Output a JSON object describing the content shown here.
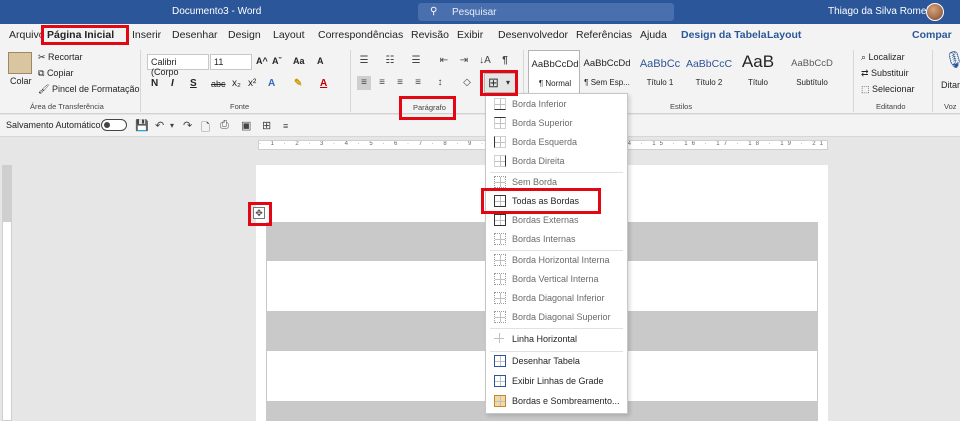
{
  "titlebar": {
    "doc_title": "Documento3  -  Word",
    "search_placeholder": "Pesquisar",
    "search_icon": "search-icon",
    "user_name": "Thiago da Silva Romeiro"
  },
  "tabs": [
    "Arquivo",
    "Página Inicial",
    "Inserir",
    "Desenhar",
    "Design",
    "Layout",
    "Correspondências",
    "Revisão",
    "Exibir",
    "Desenvolvedor",
    "Referências",
    "Ajuda",
    "Design da Tabela",
    "Layout"
  ],
  "share_label": "Compar",
  "clipboard": {
    "paste": "Colar",
    "cut": "Recortar",
    "copy": "Copiar",
    "format_painter": "Pincel de Formatação",
    "label": "Área de Transferência"
  },
  "font": {
    "family": "Calibri (Corpo",
    "size": "11",
    "label": "Fonte",
    "buttons": [
      "N",
      "I",
      "S",
      "abc",
      "x₂",
      "x²",
      "A"
    ]
  },
  "paragraph": {
    "label": "Parágrafo",
    "pilcrow": "¶",
    "sort": "↓A"
  },
  "styles": {
    "label": "Estilos",
    "items": [
      {
        "preview": "AaBbCcDd",
        "name": "¶ Normal"
      },
      {
        "preview": "AaBbCcDd",
        "name": "¶ Sem Esp..."
      },
      {
        "preview": "AaBbCc",
        "name": "Título 1"
      },
      {
        "preview": "AaBbCcC",
        "name": "Título 2"
      },
      {
        "preview": "AaB",
        "name": "Título"
      },
      {
        "preview": "AaBbCcD",
        "name": "Subtítulo"
      }
    ]
  },
  "editing": {
    "find": "Localizar",
    "replace": "Substituir",
    "select": "Selecionar",
    "label": "Editando"
  },
  "voice": {
    "dictate": "Ditar",
    "label": "Voz"
  },
  "qat": {
    "autosave": "Salvamento Automático",
    "autosave_state": "off"
  },
  "ruler_text": "· 1 · 2 · 3 · 4 · 5 · 6 · 7 · 8 · 9 · 10 · 11 · 12 · 13 · 14 · 15 · 16 · 17 · 18 · 19 · 21",
  "borders_menu": [
    {
      "label": "Borda Inferior"
    },
    {
      "label": "Borda Superior"
    },
    {
      "label": "Borda Esquerda"
    },
    {
      "label": "Borda Direita"
    },
    {
      "label": "Sem Borda"
    },
    {
      "label": "Todas as Bordas"
    },
    {
      "label": "Bordas Externas"
    },
    {
      "label": "Bordas Internas"
    },
    {
      "label": "Borda Horizontal Interna"
    },
    {
      "label": "Borda Vertical Interna"
    },
    {
      "label": "Borda Diagonal Inferior"
    },
    {
      "label": "Borda Diagonal Superior"
    },
    {
      "label": "Linha Horizontal"
    },
    {
      "label": "Desenhar Tabela"
    },
    {
      "label": "Exibir Linhas de Grade"
    },
    {
      "label": "Bordas e Sombreamento..."
    }
  ],
  "colors": {
    "accent": "#2b579a",
    "highlight": "#e30613"
  }
}
